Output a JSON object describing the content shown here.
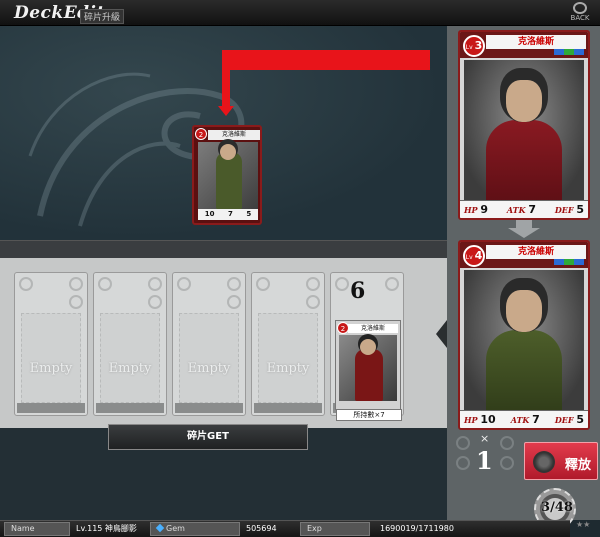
{
  "header": {
    "title": "DeckEdit",
    "subtitle": "碎片升級",
    "back_label": "BACK"
  },
  "deck_card": {
    "name": "克洛維斯",
    "level": "2",
    "hp": "10",
    "atk": "7",
    "def": "5"
  },
  "inventory": {
    "slots": [
      {
        "label": "Empty"
      },
      {
        "label": "Empty"
      },
      {
        "label": "Empty"
      },
      {
        "label": "Empty"
      }
    ],
    "card": {
      "count": "6",
      "name": "克洛維斯",
      "level": "2",
      "footer": "所持數×7"
    }
  },
  "shard_button": {
    "label": "碎片GET"
  },
  "preview": {
    "before": {
      "name": "克洛維斯",
      "lv_prefix": "Lv",
      "level": "3",
      "hp_label": "HP",
      "hp": "9",
      "atk_label": "ATK",
      "atk": "7",
      "def_label": "DEF",
      "def": "5"
    },
    "after": {
      "name": "克洛維斯",
      "lv_prefix": "Lv",
      "level": "4",
      "hp_label": "HP",
      "hp": "10",
      "atk_label": "ATK",
      "atk": "7",
      "def_label": "DEF",
      "def": "5"
    }
  },
  "cost": {
    "x": "×",
    "value": "1"
  },
  "release_button": {
    "label": "釋放"
  },
  "card_count": "3/48",
  "status": {
    "name_label": "Name",
    "name_value": "Lv.115 神鳥腳影",
    "gem_label": "Gem",
    "gem_value": "505694",
    "exp_label": "Exp",
    "exp_value": "1690019/1711980"
  },
  "colors": {
    "accent_red": "#e8141a",
    "card_border": "#8a1b1b",
    "release": "#d32c3d"
  }
}
